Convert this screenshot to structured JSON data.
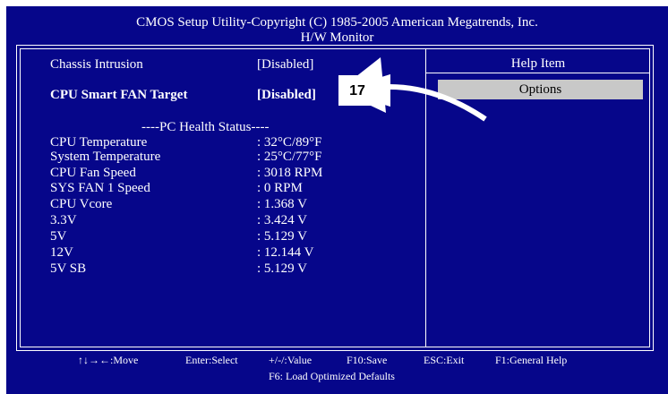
{
  "header": {
    "title": "CMOS Setup Utility-Copyright (C) 1985-2005 American Megatrends, Inc.",
    "subtitle": "H/W Monitor"
  },
  "settings": [
    {
      "label": "Chassis Intrusion",
      "value": "[Disabled]",
      "selected": false
    },
    {
      "label": "CPU Smart FAN Target",
      "value": "[Disabled]",
      "selected": true
    }
  ],
  "health": {
    "heading": "----PC Health Status----",
    "items": [
      {
        "label": "CPU Temperature",
        "value": ": 32°C/89°F"
      },
      {
        "label": "System Temperature",
        "value": ": 25°C/77°F"
      },
      {
        "label": "CPU Fan Speed",
        "value": ": 3018 RPM"
      },
      {
        "label": "SYS FAN 1 Speed",
        "value": ": 0 RPM"
      },
      {
        "label": "CPU Vcore",
        "value": ": 1.368 V"
      },
      {
        "label": "3.3V",
        "value": ": 3.424 V"
      },
      {
        "label": "5V",
        "value": ": 5.129 V"
      },
      {
        "label": "12V",
        "value": ": 12.144 V"
      },
      {
        "label": "5V SB",
        "value": ": 5.129 V"
      }
    ]
  },
  "help": {
    "title": "Help Item",
    "options_label": "Options"
  },
  "callout": {
    "label": "17"
  },
  "footer": {
    "move": "↑↓→←:Move",
    "enter": "Enter:Select",
    "value": "+/-/:Value",
    "save": "F10:Save",
    "exit": "ESC:Exit",
    "help": "F1:General Help",
    "defaults": "F6: Load Optimized Defaults"
  },
  "colors": {
    "background": "#06068a",
    "text": "#ffffff",
    "highlight": "#c8c8c8"
  }
}
